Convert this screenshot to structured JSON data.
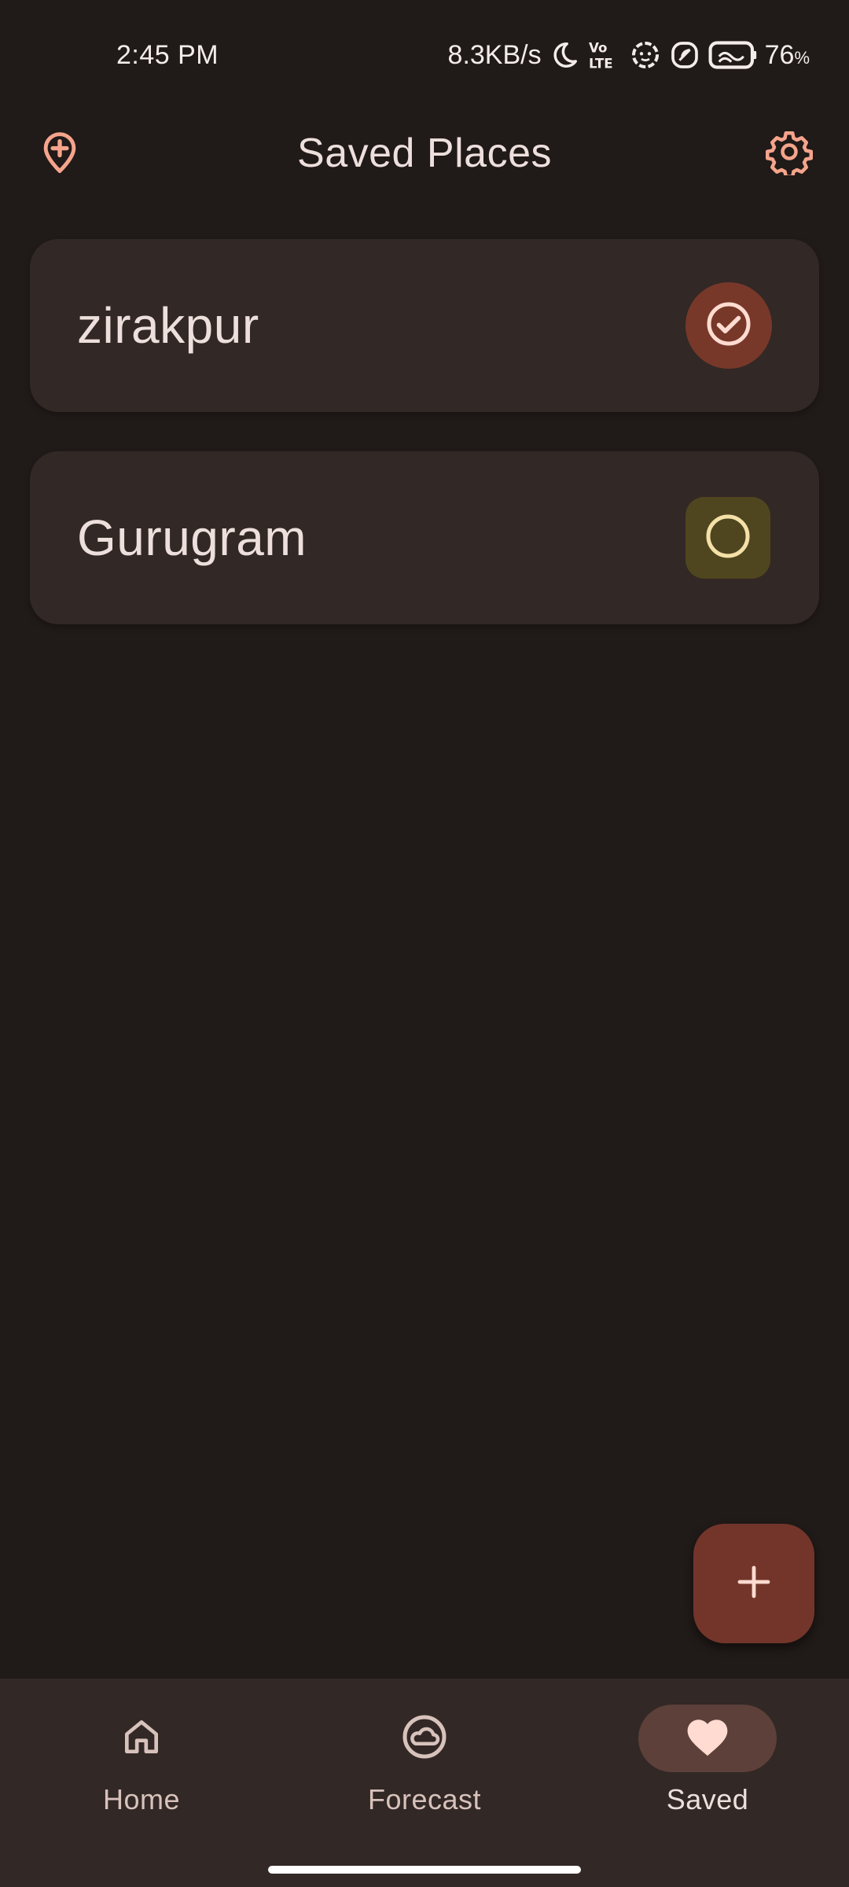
{
  "status_bar": {
    "time": "2:45 PM",
    "network_speed": "8.3KB/s",
    "battery_percent": "76",
    "battery_unit": "%",
    "icons": [
      "moon-icon",
      "volte-icon",
      "flower-icon",
      "leaf-icon",
      "battery-saver-icon"
    ]
  },
  "header": {
    "title": "Saved Places",
    "left_icon": "add-location-icon",
    "right_icon": "settings-icon"
  },
  "places": [
    {
      "name": "zirakpur",
      "selected": true,
      "indicator_icon": "check-circle-icon"
    },
    {
      "name": "Gurugram",
      "selected": false,
      "indicator_icon": "radio-unchecked-icon"
    }
  ],
  "fab": {
    "icon": "plus-icon"
  },
  "bottom_nav": {
    "items": [
      {
        "label": "Home",
        "icon": "home-icon",
        "active": false
      },
      {
        "label": "Forecast",
        "icon": "cloud-icon",
        "active": false
      },
      {
        "label": "Saved",
        "icon": "heart-icon",
        "active": true
      }
    ]
  },
  "colors": {
    "background": "#201a18",
    "card": "#322825",
    "accent": "#f5a48c",
    "selected_indicator": "#77382a",
    "unselected_indicator": "#4f461f",
    "fab": "#73352a"
  }
}
